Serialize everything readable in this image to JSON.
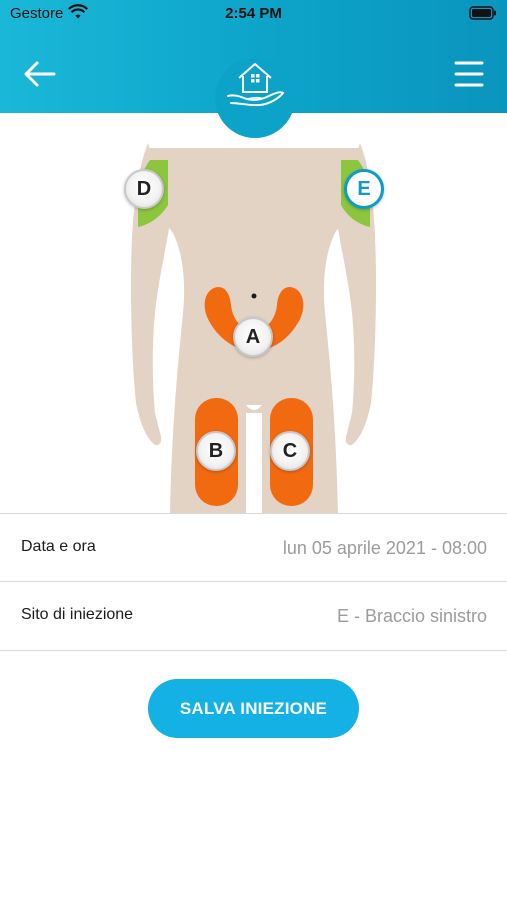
{
  "status_bar": {
    "carrier": "Gestore",
    "time": "2:54 PM",
    "icons": [
      "wifi-icon",
      "battery-icon"
    ]
  },
  "header": {
    "back_icon": "back-arrow-icon",
    "logo_icon": "house-in-hand-icon",
    "menu_icon": "hamburger-menu-icon"
  },
  "injection_sites": [
    {
      "id": "A",
      "label": "A",
      "zone": "addome"
    },
    {
      "id": "B",
      "label": "B",
      "zone": "coscia destra"
    },
    {
      "id": "C",
      "label": "C",
      "zone": "coscia sinistra"
    },
    {
      "id": "D",
      "label": "D",
      "zone": "braccio destro"
    },
    {
      "id": "E",
      "label": "E",
      "zone": "braccio sinistro",
      "selected": true
    }
  ],
  "form": {
    "date_label": "Data e ora",
    "date_value": "lun 05 aprile 2021 - 08:00",
    "site_label": "Sito di iniezione",
    "site_value": "E - Braccio sinistro"
  },
  "actions": {
    "save_label": "SALVA INIEZIONE"
  },
  "colors": {
    "header": "#0da3c9",
    "accent": "#13b1e4",
    "skin": "#e3d3c4",
    "zone_active": "#f26a10",
    "zone_arm": "#8cc63f",
    "selected_marker": "#0d9cc7"
  }
}
